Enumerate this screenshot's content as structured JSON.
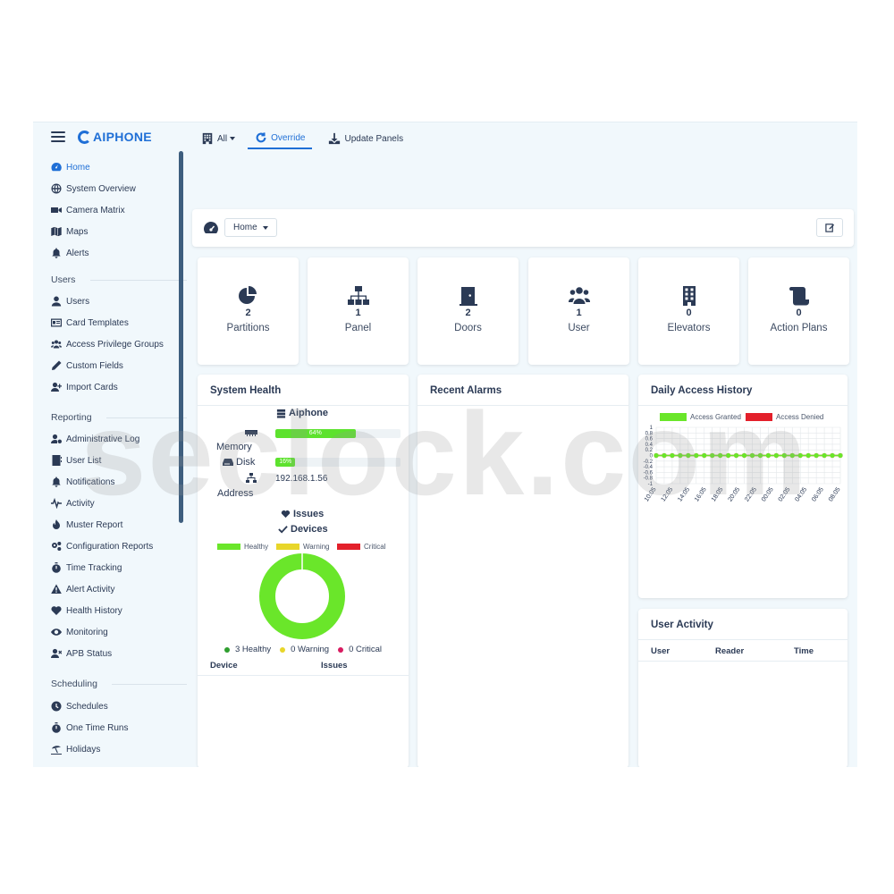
{
  "brand": {
    "name": "AIPHONE"
  },
  "toolbar": {
    "all_label": "All",
    "override_label": "Override",
    "update_label": "Update Panels"
  },
  "sidebar": {
    "main": [
      {
        "label": "Home",
        "icon": "dashboard-icon",
        "active": true
      },
      {
        "label": "System Overview",
        "icon": "globe-icon"
      },
      {
        "label": "Camera Matrix",
        "icon": "video-camera-icon"
      },
      {
        "label": "Maps",
        "icon": "map-icon"
      },
      {
        "label": "Alerts",
        "icon": "bell-icon"
      }
    ],
    "users_header": "Users",
    "users": [
      {
        "label": "Users",
        "icon": "user-icon"
      },
      {
        "label": "Card Templates",
        "icon": "id-card-icon"
      },
      {
        "label": "Access Privilege Groups",
        "icon": "users-icon"
      },
      {
        "label": "Custom Fields",
        "icon": "pen-icon"
      },
      {
        "label": "Import Cards",
        "icon": "user-plus-icon"
      }
    ],
    "reporting_header": "Reporting",
    "reporting": [
      {
        "label": "Administrative Log",
        "icon": "user-gear-icon"
      },
      {
        "label": "User List",
        "icon": "address-book-icon"
      },
      {
        "label": "Notifications",
        "icon": "bell-icon"
      },
      {
        "label": "Activity",
        "icon": "pulse-icon"
      },
      {
        "label": "Muster Report",
        "icon": "fire-icon"
      },
      {
        "label": "Configuration Reports",
        "icon": "gears-icon"
      },
      {
        "label": "Time Tracking",
        "icon": "stopwatch-icon"
      },
      {
        "label": "Alert Activity",
        "icon": "warning-icon"
      },
      {
        "label": "Health History",
        "icon": "heart-pulse-icon"
      },
      {
        "label": "Monitoring",
        "icon": "eye-icon"
      },
      {
        "label": "APB Status",
        "icon": "user-x-icon"
      }
    ],
    "scheduling_header": "Scheduling",
    "scheduling": [
      {
        "label": "Schedules",
        "icon": "clock-icon"
      },
      {
        "label": "One Time Runs",
        "icon": "stopwatch-icon"
      },
      {
        "label": "Holidays",
        "icon": "umbrella-beach-icon"
      }
    ]
  },
  "home": {
    "select_label": "Home"
  },
  "stats": [
    {
      "value": "2",
      "label": "Partitions",
      "icon": "pie-chart-icon"
    },
    {
      "value": "1",
      "label": "Panel",
      "icon": "network-icon"
    },
    {
      "value": "2",
      "label": "Doors",
      "icon": "door-icon"
    },
    {
      "value": "1",
      "label": "User",
      "icon": "users-icon"
    },
    {
      "value": "0",
      "label": "Elevators",
      "icon": "building-icon"
    },
    {
      "value": "0",
      "label": "Action Plans",
      "icon": "scroll-icon"
    }
  ],
  "health": {
    "title": "System Health",
    "server_name": "Aiphone",
    "memory_label": "Memory",
    "memory_percent": 64,
    "memory_text": "64%",
    "disk_label": "Disk",
    "disk_percent": 16,
    "disk_text": "16%",
    "address_label": "Address",
    "address_value": "192.168.1.56",
    "issues_label": "Issues",
    "devices_label": "Devices",
    "legend": [
      {
        "name": "Healthy",
        "color": "#6ae62a"
      },
      {
        "name": "Warning",
        "color": "#e8d62a"
      },
      {
        "name": "Critical",
        "color": "#e3202b"
      }
    ],
    "donut": {
      "healthy": 3,
      "warning": 0,
      "critical": 0
    },
    "summary": {
      "healthy": "3 Healthy",
      "warning": "0 Warning",
      "critical": "0 Critical"
    },
    "table_headers": {
      "device": "Device",
      "issues": "Issues"
    }
  },
  "alarms": {
    "title": "Recent Alarms"
  },
  "daily": {
    "title": "Daily Access History",
    "legend": [
      {
        "name": "Access Granted",
        "color": "#6ae62a"
      },
      {
        "name": "Access Denied",
        "color": "#e3202b"
      }
    ]
  },
  "activity": {
    "title": "User Activity",
    "headers": {
      "user": "User",
      "reader": "Reader",
      "time": "Time"
    }
  },
  "watermark": "seclock.com",
  "chart_data": {
    "type": "line",
    "title": "Daily Access History",
    "x": [
      "10:05",
      "12:05",
      "14:05",
      "16:05",
      "18:05",
      "20:05",
      "22:05",
      "00:05",
      "02:05",
      "04:05",
      "06:05",
      "08:05"
    ],
    "yticks": [
      "1",
      "0.8",
      "0.6",
      "0.4",
      "0.2",
      "0",
      "-0.2",
      "-0.4",
      "-0.6",
      "-0.8",
      "-1"
    ],
    "ylim": [
      -1,
      1
    ],
    "grid": true,
    "legend_position": "top",
    "series": [
      {
        "name": "Access Granted",
        "color": "#6ae62a",
        "values": [
          0,
          0,
          0,
          0,
          0,
          0,
          0,
          0,
          0,
          0,
          0,
          0,
          0,
          0,
          0,
          0,
          0,
          0,
          0,
          0,
          0,
          0,
          0,
          0
        ]
      },
      {
        "name": "Access Denied",
        "color": "#e3202b",
        "values": [
          0,
          0,
          0,
          0,
          0,
          0,
          0,
          0,
          0,
          0,
          0,
          0,
          0,
          0,
          0,
          0,
          0,
          0,
          0,
          0,
          0,
          0,
          0,
          0
        ]
      }
    ]
  }
}
